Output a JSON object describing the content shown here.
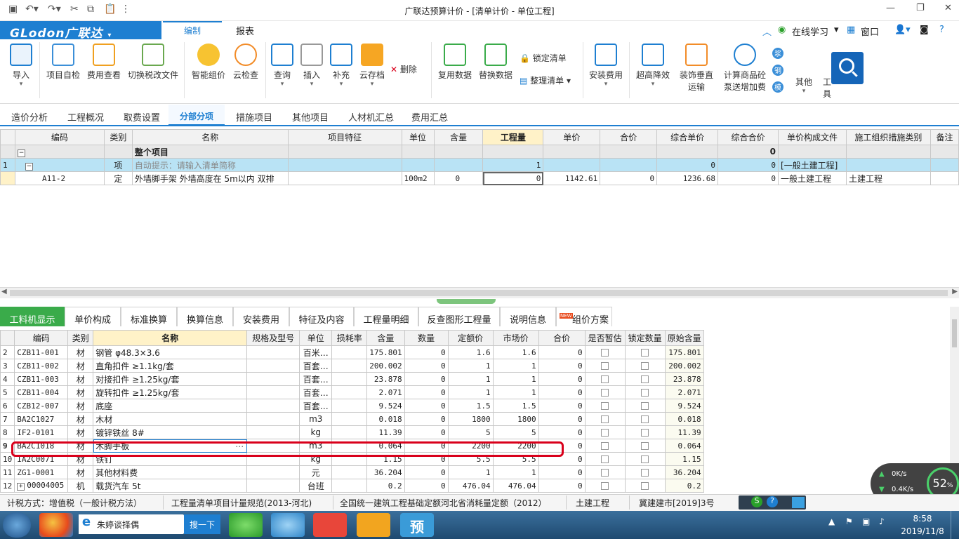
{
  "window": {
    "title": "广联达预算计价 - [清单计价 - 单位工程]",
    "controls": [
      "minimize",
      "restore",
      "close"
    ]
  },
  "quick_access": [
    "save-icon",
    "undo-icon",
    "redo-icon",
    "cut-icon",
    "copy-icon",
    "paste-icon",
    "more-icon"
  ],
  "menubar": {
    "logo": "GLodon广联达",
    "tabs": [
      "编制",
      "报表"
    ],
    "right": {
      "online_learning": "在线学习",
      "window": "窗口",
      "help": "?"
    }
  },
  "ribbon": {
    "buttons": [
      {
        "label": "导入",
        "icon": "import-icon"
      },
      {
        "label": "项目自检",
        "icon": "project-check-icon"
      },
      {
        "label": "费用查看",
        "icon": "fee-view-icon"
      },
      {
        "label": "切换税改文件",
        "icon": "tax-switch-icon"
      },
      {
        "label": "智能组价",
        "icon": "smart-price-icon"
      },
      {
        "label": "云检查",
        "icon": "cloud-check-icon"
      },
      {
        "label": "查询",
        "icon": "query-icon"
      },
      {
        "label": "插入",
        "icon": "insert-icon"
      },
      {
        "label": "补充",
        "icon": "supplement-icon"
      },
      {
        "label": "云存档",
        "icon": "cloud-archive-icon"
      },
      {
        "label": "删除",
        "icon": "delete-icon"
      },
      {
        "label": "复用数据",
        "icon": "reuse-data-icon"
      },
      {
        "label": "替换数据",
        "icon": "replace-data-icon"
      },
      {
        "label": "锁定清单",
        "icon": "lock-list-icon"
      },
      {
        "label": "整理清单",
        "icon": "organize-list-icon"
      },
      {
        "label": "安装费用",
        "icon": "install-fee-icon"
      },
      {
        "label": "超高降效",
        "icon": "height-reduction-icon"
      },
      {
        "label": "装饰垂直运输",
        "icon": "vertical-transport-icon"
      },
      {
        "label": "计算商品砼泵送增加费",
        "icon": "concrete-pump-icon"
      },
      {
        "label": "其他",
        "icon": "other-icon"
      },
      {
        "label": "工具",
        "icon": "tools-icon"
      }
    ],
    "side_icons": [
      "浆",
      "钢",
      "模"
    ]
  },
  "nav_tabs": [
    "造价分析",
    "工程概况",
    "取费设置",
    "分部分项",
    "措施项目",
    "其他项目",
    "人材机汇总",
    "费用汇总"
  ],
  "upper_table": {
    "headers": [
      "编码",
      "类别",
      "名称",
      "项目特征",
      "单位",
      "含量",
      "工程量",
      "单价",
      "合价",
      "综合单价",
      "综合合价",
      "单价构成文件",
      "施工组织措施类别",
      "备注"
    ],
    "rows": [
      {
        "idx": "",
        "code": "",
        "type": "",
        "name": "整个项目",
        "feature": "",
        "unit": "",
        "content": "",
        "qty": "",
        "price": "",
        "total": "",
        "comp_price": "",
        "comp_total": "0",
        "file": "",
        "category": ""
      },
      {
        "idx": "1",
        "code": "",
        "type": "项",
        "name": "自动提示：请输入清单简称",
        "feature": "",
        "unit": "",
        "content": "",
        "qty": "1",
        "price": "",
        "total": "",
        "comp_price": "0",
        "comp_total": "0",
        "file": "[一般土建工程]",
        "category": ""
      },
      {
        "idx": "",
        "code": "A11-2",
        "type": "定",
        "name": "外墙脚手架 外墙高度在 5m以内 双排",
        "feature": "",
        "unit": "100m2",
        "content": "0",
        "qty": "0",
        "price": "1142.61",
        "total": "0",
        "comp_price": "1236.68",
        "comp_total": "0",
        "file": "一般土建工程",
        "category": "土建工程"
      }
    ]
  },
  "lower_tabs": [
    "工料机显示",
    "单价构成",
    "标准换算",
    "换算信息",
    "安装费用",
    "特征及内容",
    "工程量明细",
    "反查图形工程量",
    "说明信息",
    "组价方案"
  ],
  "lower_table": {
    "headers": [
      "编码",
      "类别",
      "名称",
      "规格及型号",
      "单位",
      "损耗率",
      "含量",
      "数量",
      "定额价",
      "市场价",
      "合价",
      "是否暂估",
      "锁定数量",
      "原始含量"
    ],
    "rows": [
      {
        "idx": "2",
        "code": "CZB11-001",
        "type": "材",
        "name": "钢管 φ48.3×3.6",
        "unit": "百米…",
        "content": "175.801",
        "qty": "0",
        "quota": "1.6",
        "market": "1.6",
        "total": "0",
        "orig": "175.801"
      },
      {
        "idx": "3",
        "code": "CZB11-002",
        "type": "材",
        "name": "直角扣件 ≥1.1kg/套",
        "unit": "百套…",
        "content": "200.002",
        "qty": "0",
        "quota": "1",
        "market": "1",
        "total": "0",
        "orig": "200.002"
      },
      {
        "idx": "4",
        "code": "CZB11-003",
        "type": "材",
        "name": "对接扣件 ≥1.25kg/套",
        "unit": "百套…",
        "content": "23.878",
        "qty": "0",
        "quota": "1",
        "market": "1",
        "total": "0",
        "orig": "23.878"
      },
      {
        "idx": "5",
        "code": "CZB11-004",
        "type": "材",
        "name": "旋转扣件 ≥1.25kg/套",
        "unit": "百套…",
        "content": "2.071",
        "qty": "0",
        "quota": "1",
        "market": "1",
        "total": "0",
        "orig": "2.071"
      },
      {
        "idx": "6",
        "code": "CZB12-007",
        "type": "材",
        "name": "底座",
        "unit": "百套…",
        "content": "9.524",
        "qty": "0",
        "quota": "1.5",
        "market": "1.5",
        "total": "0",
        "orig": "9.524"
      },
      {
        "idx": "7",
        "code": "BA2C1027",
        "type": "材",
        "name": "木材",
        "unit": "m3",
        "content": "0.018",
        "qty": "0",
        "quota": "1800",
        "market": "1800",
        "total": "0",
        "orig": "0.018"
      },
      {
        "idx": "8",
        "code": "IF2-0101",
        "type": "材",
        "name": "镀锌铁丝 8#",
        "unit": "kg",
        "content": "11.39",
        "qty": "0",
        "quota": "5",
        "market": "5",
        "total": "0",
        "orig": "11.39"
      },
      {
        "idx": "9",
        "code": "BA2C1018",
        "type": "材",
        "name": "木脚手板",
        "unit": "m3",
        "content": "0.064",
        "qty": "0",
        "quota": "2200",
        "market": "2200",
        "total": "0",
        "orig": "0.064"
      },
      {
        "idx": "10",
        "code": "IA2C0071",
        "type": "材",
        "name": "铁钉",
        "unit": "kg",
        "content": "1.15",
        "qty": "0",
        "quota": "5.5",
        "market": "5.5",
        "total": "0",
        "orig": "1.15"
      },
      {
        "idx": "11",
        "code": "ZG1-0001",
        "type": "材",
        "name": "其他材料费",
        "unit": "元",
        "content": "36.204",
        "qty": "0",
        "quota": "1",
        "market": "1",
        "total": "0",
        "orig": "36.204"
      },
      {
        "idx": "12",
        "code": "00004005",
        "type": "机",
        "name": "载货汽车 5t",
        "unit": "台班",
        "content": "0.2",
        "qty": "0",
        "quota": "476.04",
        "market": "476.04",
        "total": "0",
        "orig": "0.2"
      }
    ]
  },
  "statusbar": [
    "计税方式：增值税（一般计税方法）",
    "工程量清单项目计量规范(2013-河北)",
    "全国统一建筑工程基础定额河北省消耗量定额（2012）",
    "土建工程",
    "冀建建市[2019]3号"
  ],
  "speed_widget": {
    "up": "0K/s",
    "down": "0.4K/s",
    "percent": "52",
    "percent_sign": "%"
  },
  "taskbar": {
    "search_text": "朱婷谈择偶",
    "search_button": "搜一下",
    "time": "8:58",
    "date": "2019/11/8",
    "pinned": [
      "start-orb-icon",
      "app-colorful-icon",
      "ie-browser-icon",
      "360-browser-icon",
      "chat-app-icon",
      "gift-app-icon",
      "glodon-app-icon",
      "yu-app-icon"
    ]
  },
  "colors": {
    "brand": "#1e7fd1",
    "active_tab": "#3aab4a",
    "highlight_row": "#b9e3f5",
    "annotation": "#d9001b"
  }
}
